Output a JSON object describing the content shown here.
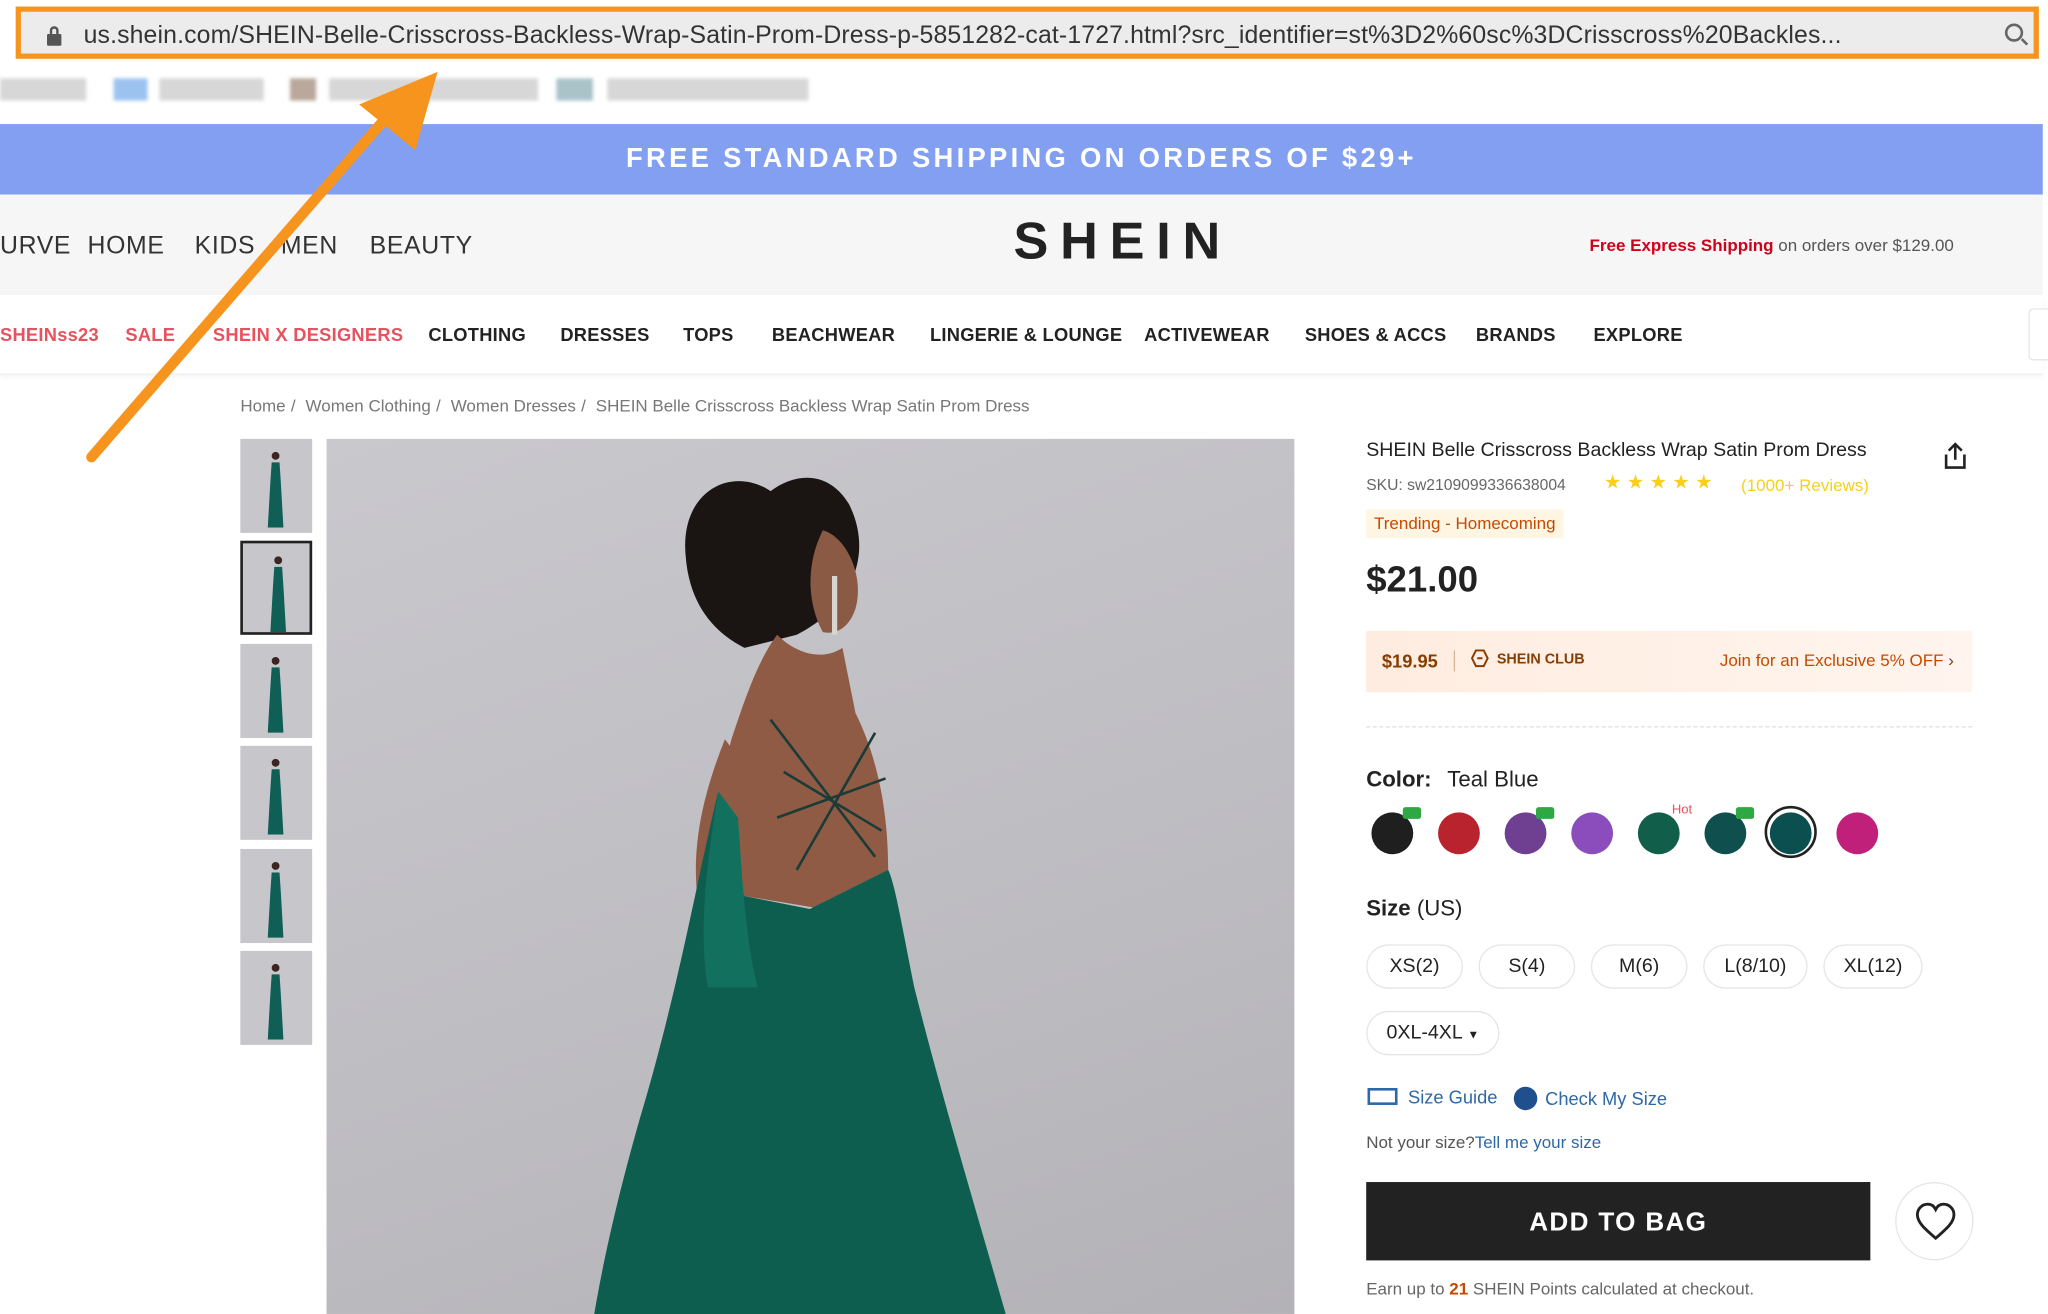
{
  "browser": {
    "url": "us.shein.com/SHEIN-Belle-Crisscross-Backless-Wrap-Satin-Prom-Dress-p-5851282-cat-1727.html?src_identifier=st%3D2%60sc%3DCrisscross%20Backles..."
  },
  "banner": {
    "text": "FREE STANDARD SHIPPING ON ORDERS OF $29+"
  },
  "header": {
    "channels": [
      "URVE",
      "HOME",
      "KIDS",
      "MEN",
      "BEAUTY"
    ],
    "logo": "SHEIN",
    "express_highlight": "Free Express Shipping",
    "express_rest": " on orders over $129.00"
  },
  "nav": {
    "items": [
      "SHEINss23",
      "SALE",
      "SHEIN X DESIGNERS",
      "CLOTHING",
      "DRESSES",
      "TOPS",
      "BEACHWEAR",
      "LINGERIE & LOUNGE",
      "ACTIVEWEAR",
      "SHOES & ACCS",
      "BRANDS",
      "EXPLORE"
    ],
    "accent_color": "#e8515e"
  },
  "breadcrumb": [
    "Home",
    "Women Clothing",
    "Women Dresses",
    "SHEIN Belle Crisscross Backless Wrap Satin Prom Dress"
  ],
  "product": {
    "title": "SHEIN Belle Crisscross Backless Wrap Satin Prom Dress",
    "sku": "SKU: sw2109099336638004",
    "rating": 4.5,
    "reviews": "(1000+ Reviews)",
    "trending": "Trending - Homecoming",
    "price": "$21.00",
    "club_price": "$19.95",
    "club_name": "SHEIN CLUB",
    "club_offer": "Join for an Exclusive 5% OFF",
    "color_label": "Color:",
    "color_value": "Teal Blue",
    "colors": [
      "#1f1f1f",
      "#b8232e",
      "#6f3f92",
      "#8a4dbb",
      "#115f4a",
      "#0f4f4d",
      "#0c4f51",
      "#c0207a"
    ],
    "selected_color_index": 6,
    "hot_label": "Hot",
    "size_label": "Size",
    "size_unit": " (US)",
    "sizes": [
      "XS(2)",
      "S(4)",
      "M(6)",
      "L(8/10)",
      "XL(12)"
    ],
    "plus_sizes": "0XL-4XL",
    "size_guide": "Size Guide",
    "check_size": "Check My Size",
    "not_your_size": "Not your size?",
    "tell_size": "Tell me your size",
    "add_to_bag": "ADD TO BAG",
    "points_prefix": "Earn up to ",
    "points_value": "21",
    "points_suffix": " SHEIN Points calculated at checkout."
  },
  "annotation": {
    "arrow_color": "#f7941d"
  }
}
